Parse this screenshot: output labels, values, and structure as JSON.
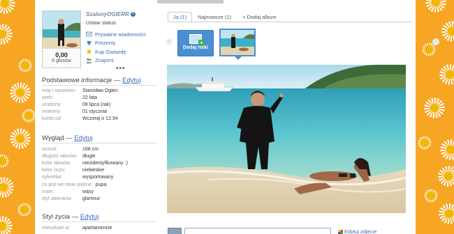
{
  "profile": {
    "username": "SzalonyOGIERR",
    "status": "Ustaw status",
    "score": "0,00",
    "score_label": "0 głosów",
    "more": "•••",
    "actions": [
      {
        "label": "Prywatne wiadomości",
        "icon": "envelope-icon"
      },
      {
        "label": "Prezenty",
        "icon": "gift-icon"
      },
      {
        "label": "Kup Gwiazdę",
        "icon": "star-icon"
      },
      {
        "label": "Znajomi",
        "icon": "friends-icon"
      }
    ]
  },
  "basic": {
    "title": "Podstawowe informacje",
    "sep": " — ",
    "edit": "Edytuj",
    "rows": [
      {
        "k": "imię i nazwisko:",
        "v": "Stanisław Ogien"
      },
      {
        "k": "wiek:",
        "v": "22 lata"
      },
      {
        "k": "urodziny:",
        "v": "08 lipca (rak)"
      },
      {
        "k": "imieniny:",
        "v": "01 stycznia"
      },
      {
        "k": "konto od:",
        "v": "Wczoraj o 12:34"
      }
    ]
  },
  "look": {
    "title": "Wygląd",
    "sep": " — ",
    "edit": "Edytuj",
    "rows": [
      {
        "k": "wzrost:",
        "v": "168 cm"
      },
      {
        "k": "długość włosów:",
        "v": "długie"
      },
      {
        "k": "kolor włosów:",
        "v": "niezidentyfikowany :)"
      },
      {
        "k": "kolor oczu:",
        "v": "niebieskie"
      },
      {
        "k": "sylwetka:",
        "v": "wysportowany"
      },
      {
        "k": "co jest we mnie piękne:",
        "v": "pupa"
      },
      {
        "k": "mam:",
        "v": "wąsy"
      },
      {
        "k": "styl ubierania:",
        "v": "glamour"
      }
    ]
  },
  "life": {
    "title": "Styl życia",
    "sep": " — ",
    "edit": "Edytuj",
    "rows": [
      {
        "k": "mieszkam w:",
        "v": "apartamencie"
      }
    ]
  },
  "tabs": [
    {
      "label": "Ja (1)",
      "active": true
    },
    {
      "label": "Najnowsze (1)",
      "active": false
    },
    {
      "label": "+ Dodaj album",
      "active": false
    }
  ],
  "gallery": {
    "add_label": "Dodaj fotki",
    "prev": "‹",
    "next": "›"
  },
  "bottom": {
    "edit_photo": "Edytuj zdjęcie"
  },
  "colors": {
    "background": "#f6a623",
    "link": "#3a6db5",
    "accent": "#4a8fd1"
  }
}
